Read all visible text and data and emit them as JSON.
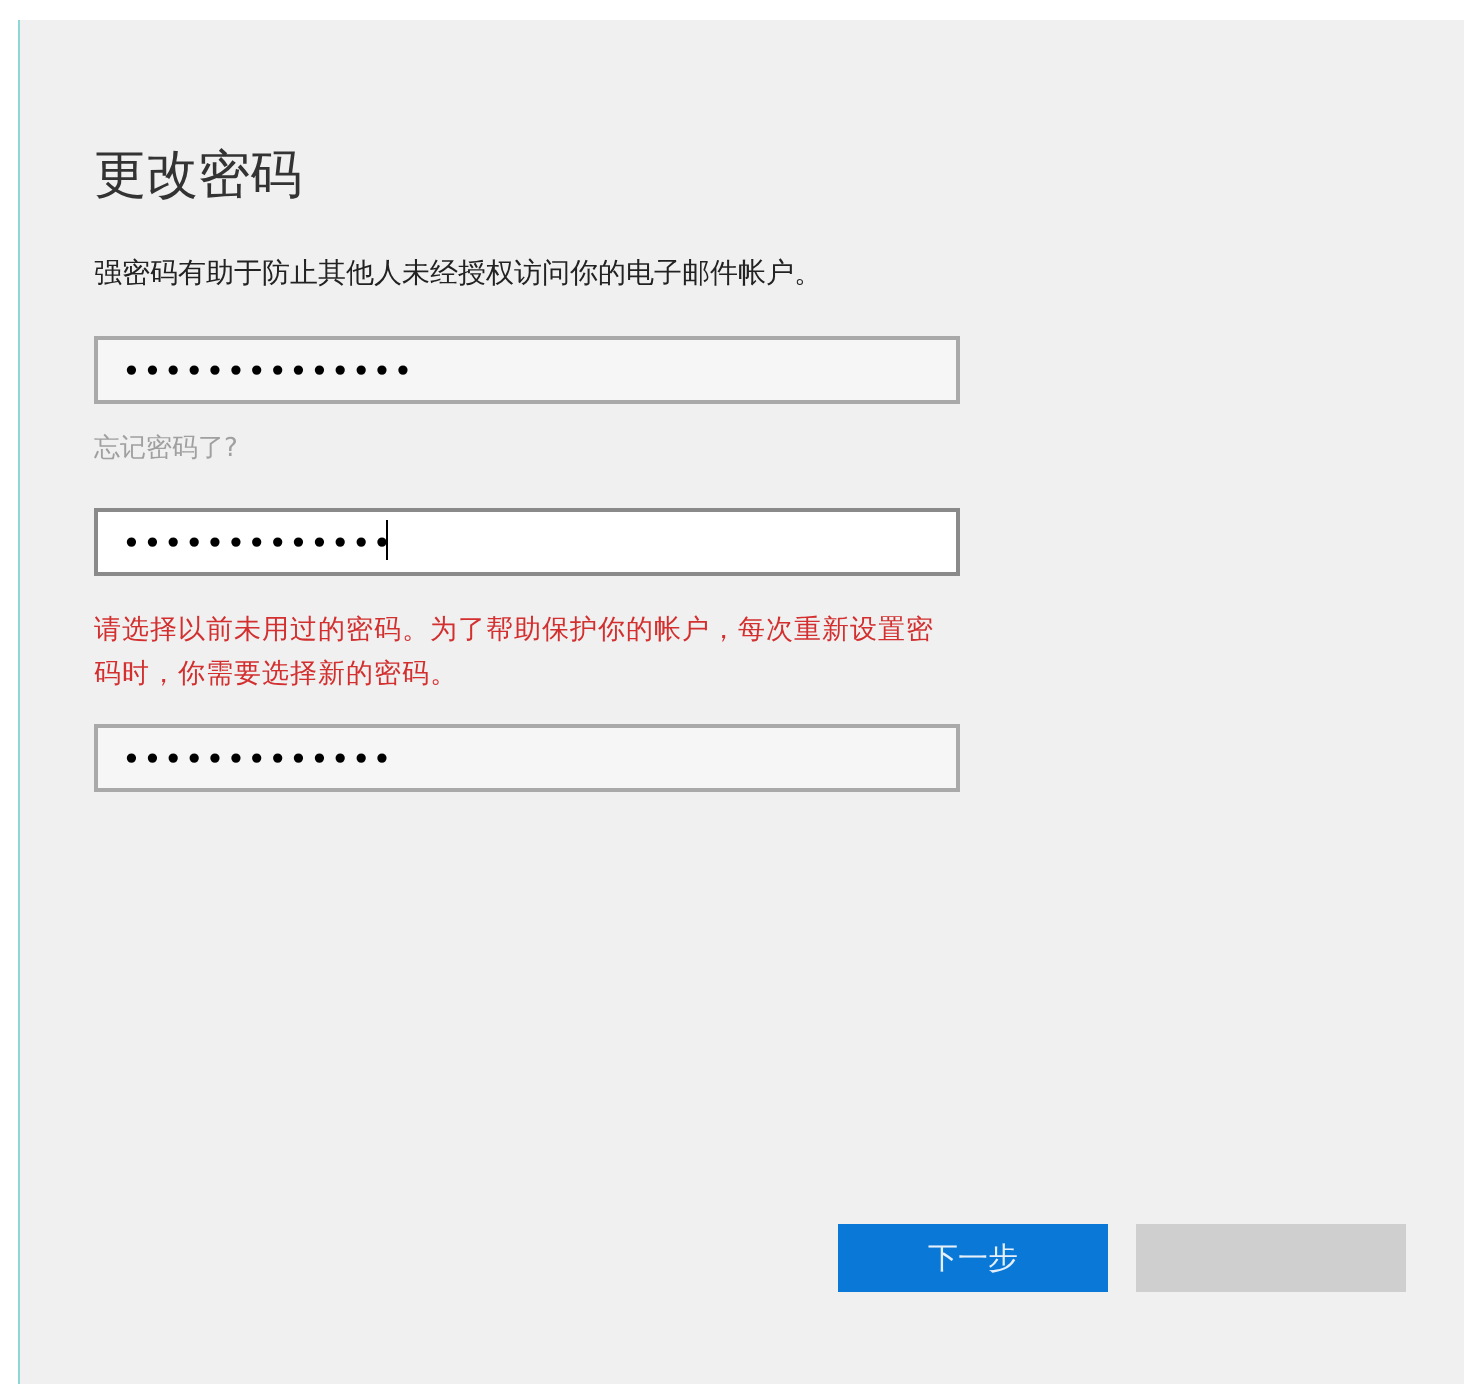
{
  "title": "更改密码",
  "description": "强密码有助于防止其他人未经授权访问你的电子邮件帐户。",
  "fields": [
    {
      "kind": "password",
      "value": "••••••••••••••",
      "focused": false
    },
    {
      "kind": "link",
      "text": "忘记密码了?",
      "disabled": true
    },
    {
      "kind": "password",
      "value": "•••••••••••••",
      "focused": true
    },
    {
      "kind": "error",
      "text": "请选择以前未用过的密码。为了帮助保护你的帐户，每次重新设置密码时，你需要选择新的密码。"
    },
    {
      "kind": "password",
      "value": "•••••••••••••",
      "focused": false
    }
  ],
  "buttons": [
    {
      "label": "下一步",
      "kind": "primary"
    },
    {
      "kind": "secondary"
    }
  ]
}
